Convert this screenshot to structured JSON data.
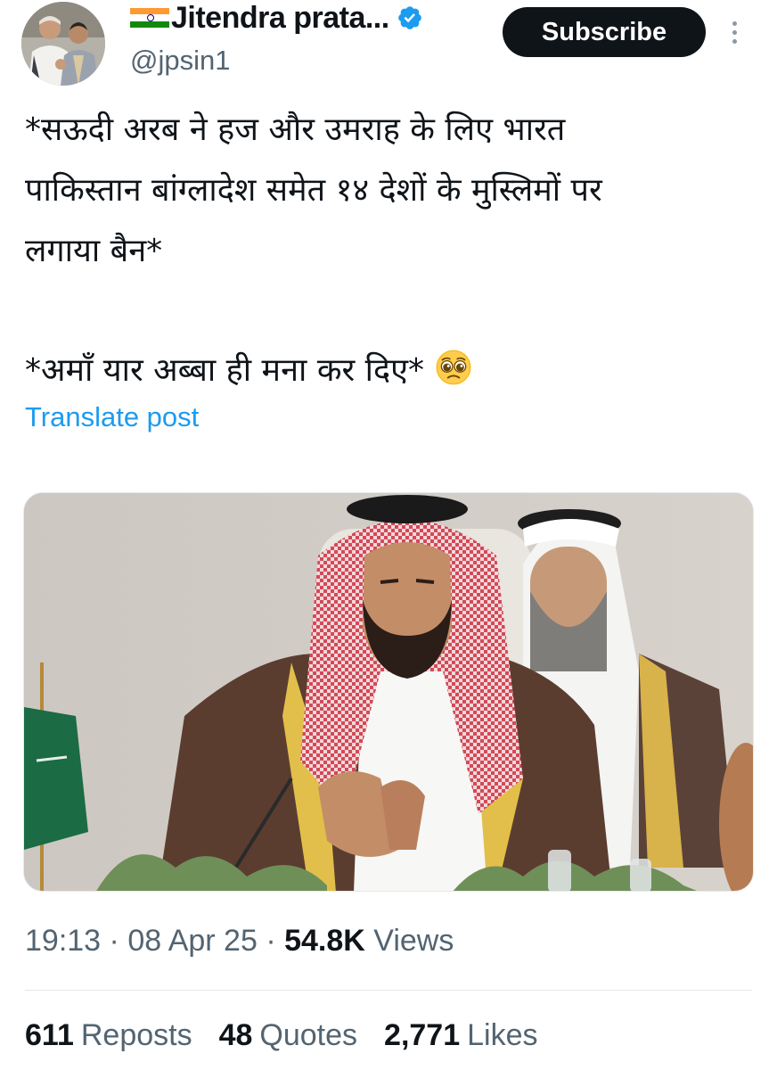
{
  "author": {
    "display_name": "Jitendra prata...",
    "handle": "@jpsin1",
    "verified": true,
    "flag": "india-flag"
  },
  "header": {
    "subscribe_label": "Subscribe"
  },
  "tweet": {
    "lines": [
      "*सऊदी अरब ने हज और उमराह के लिए भारत",
      "पाकिस्तान बांग्लादेश समेत १४ देशों के मुस्लिमों पर",
      "लगाया बैन*"
    ],
    "second_line": "*अमाँ यार अब्बा ही मना कर दिए*",
    "emoji": "pleading-face-emoji",
    "translate_label": "Translate post"
  },
  "meta": {
    "time": "19:13",
    "sep1": " · ",
    "date": "08 Apr 25",
    "sep2": " · ",
    "views_count": "54.8K",
    "views_label": "Views"
  },
  "stats": {
    "reposts_count": "611",
    "reposts_label": "Reposts",
    "quotes_count": "48",
    "quotes_label": "Quotes",
    "likes_count": "2,771",
    "likes_label": "Likes"
  },
  "colors": {
    "link": "#1d9bf0",
    "secondary_text": "#536471",
    "primary_text": "#0f1419",
    "verified": "#1d9bf0"
  }
}
